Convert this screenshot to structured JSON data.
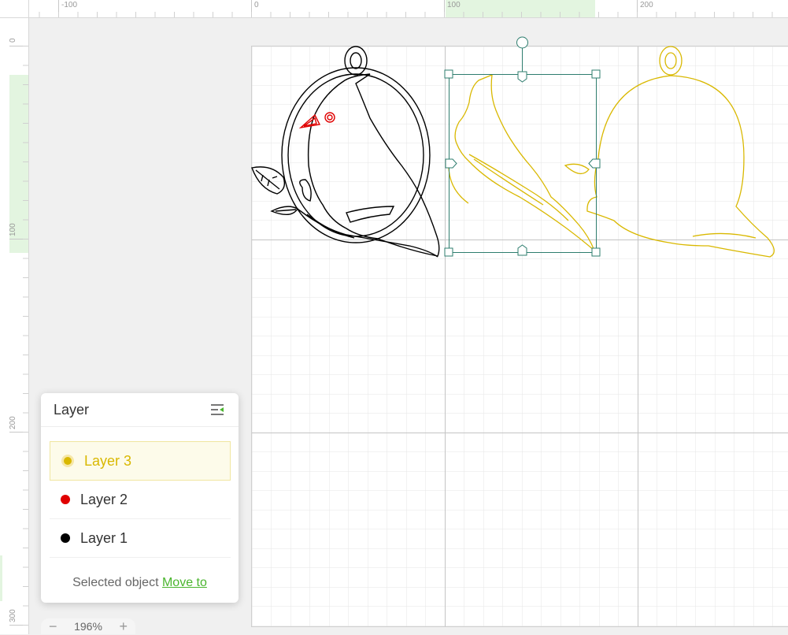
{
  "ruler": {
    "top_labels": [
      "-100",
      "0",
      "100",
      "200"
    ],
    "left_labels": [
      "0",
      "100",
      "200",
      "300"
    ]
  },
  "layer_panel": {
    "title": "Layer",
    "menu_icon": "layer-options-icon",
    "layers": [
      {
        "name": "Layer 3",
        "color": "#d9b800",
        "active": true
      },
      {
        "name": "Layer 2",
        "color": "#e00000",
        "active": false
      },
      {
        "name": "Layer 1",
        "color": "#000000",
        "active": false
      }
    ],
    "footer_text": "Selected object",
    "footer_link": "Move to"
  },
  "zoom": {
    "value": "196%",
    "minus": "−",
    "plus": "+"
  },
  "colors": {
    "layer1": "#000000",
    "layer2": "#e00000",
    "layer3": "#d9b800",
    "selection": "#2e7d6e"
  }
}
